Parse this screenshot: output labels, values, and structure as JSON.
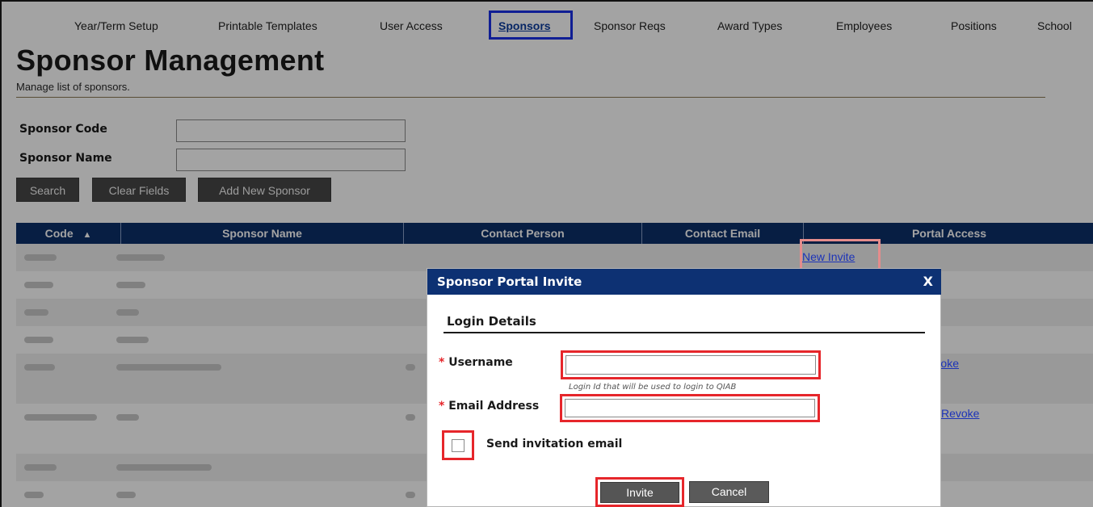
{
  "nav": {
    "items": [
      {
        "label": "Year/Term Setup"
      },
      {
        "label": "Printable Templates"
      },
      {
        "label": "User Access"
      },
      {
        "label": "Sponsors",
        "active": true
      },
      {
        "label": "Sponsor Reqs"
      },
      {
        "label": "Award Types"
      },
      {
        "label": "Employees"
      },
      {
        "label": "Positions"
      },
      {
        "label": "School"
      }
    ]
  },
  "header": {
    "title": "Sponsor Management",
    "subtitle": "Manage list of sponsors."
  },
  "search": {
    "code_label": "Sponsor Code",
    "code_value": "",
    "name_label": "Sponsor Name",
    "name_value": "",
    "search_label": "Search",
    "clear_label": "Clear Fields",
    "add_label": "Add New Sponsor"
  },
  "grid": {
    "columns": [
      "Code",
      "Sponsor Name",
      "Contact Person",
      "Contact Email",
      "Portal Access"
    ],
    "sort_icon": "sort-asc-icon",
    "rows": [
      {
        "portal": "New Invite"
      },
      {
        "portal": ""
      },
      {
        "portal": ""
      },
      {
        "portal": ""
      },
      {
        "portal": "Revoke"
      },
      {
        "portal": "Revoke"
      },
      {
        "portal": ""
      },
      {
        "portal": ""
      }
    ]
  },
  "dialog": {
    "title": "Sponsor Portal Invite",
    "close_label": "X",
    "section_title": "Login Details",
    "username_label": "Username",
    "username_value": "",
    "username_hint": "Login Id that will be used to login to QIAB",
    "email_label": "Email Address",
    "email_value": "",
    "send_email_label": "Send invitation email",
    "send_email_checked": false,
    "invite_label": "Invite",
    "cancel_label": "Cancel"
  },
  "colors": {
    "nav_active": "#0c3c9e",
    "grid_header": "#0b2f6a",
    "dialog_header": "#0d3173",
    "highlight_red": "#e6262b",
    "highlight_blue": "#1a30e8"
  }
}
